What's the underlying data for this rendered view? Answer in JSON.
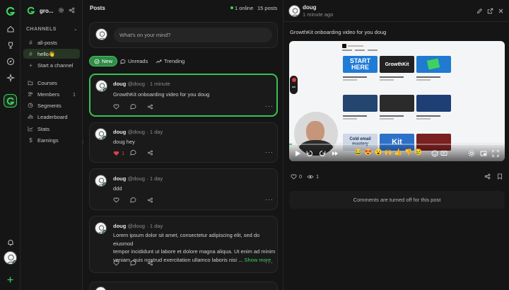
{
  "workspace": {
    "name": "gro..."
  },
  "sidebar": {
    "section_label": "CHANNELS",
    "items": [
      {
        "label": "all-posts",
        "icon": "hash-icon"
      },
      {
        "label": "hello👋",
        "icon": "hash-icon",
        "active": true
      },
      {
        "label": "Start a channel",
        "icon": "plus-icon"
      },
      {
        "label": "Courses",
        "icon": "folder-icon"
      },
      {
        "label": "Members",
        "icon": "users-icon",
        "count": "1"
      },
      {
        "label": "Segments",
        "icon": "segments-icon"
      },
      {
        "label": "Leaderboard",
        "icon": "leaderboard-icon"
      },
      {
        "label": "Stats",
        "icon": "stats-icon"
      },
      {
        "label": "Earnings",
        "icon": "dollar-icon"
      }
    ]
  },
  "posts_panel": {
    "title": "Posts",
    "online": "1 online",
    "post_count": "15 posts",
    "composer_placeholder": "What's on your mind?",
    "tabs": [
      {
        "label": "New",
        "active": true
      },
      {
        "label": "Unreads"
      },
      {
        "label": "Trending"
      }
    ],
    "posts": [
      {
        "author": "doug",
        "handle": "@doug",
        "time": "1 minute",
        "body": "GrowthKit onboarding video for you doug",
        "likes": "",
        "liked": false
      },
      {
        "author": "doug",
        "handle": "@doug",
        "time": "1 day",
        "body": "doug hey",
        "likes": "1",
        "liked": true
      },
      {
        "author": "doug",
        "handle": "@doug",
        "time": "1 day",
        "body": "ddd",
        "likes": "",
        "liked": false
      },
      {
        "author": "doug",
        "handle": "@doug",
        "time": "1 day",
        "body_lines": [
          "Lorem ipsum dolor sit amet, consectetur adipiscing elit, sed do eiusmod",
          "tempor incididunt ut labore et dolore magna aliqua. Ut enim ad minim",
          "veniam, quis nostrud exercitation ullamco laboris nisi ..."
        ],
        "show_more": "Show more",
        "likes": "",
        "liked": false
      }
    ]
  },
  "detail": {
    "author": "doug",
    "time": "1 minute ago",
    "body": "GrowthKit onboarding video for you doug",
    "likes": "0",
    "views": "1",
    "comments_off": "Comments are turned off for this post",
    "video": {
      "tiles": [
        {
          "title": "START HERE",
          "color": "#1e7bd6"
        },
        {
          "title": "GrowthKit",
          "color": "#222"
        },
        {
          "title": "",
          "color": "#1f7ad0"
        },
        {
          "title": "",
          "color": "#23456f"
        },
        {
          "title": "",
          "color": "#2b2b2b"
        },
        {
          "title": "",
          "color": "#1d3f75"
        },
        {
          "title": "Cold email mastery",
          "color": "#cfd8e6"
        },
        {
          "title": "Kit",
          "color": "#2e71c9"
        },
        {
          "title": "",
          "color": "#7a2020"
        }
      ],
      "reactions": [
        "😂",
        "😍",
        "😮",
        "🙌",
        "👍",
        "👎",
        "😢"
      ]
    }
  },
  "colors": {
    "accent": "#39c155",
    "like": "#e0404b"
  }
}
